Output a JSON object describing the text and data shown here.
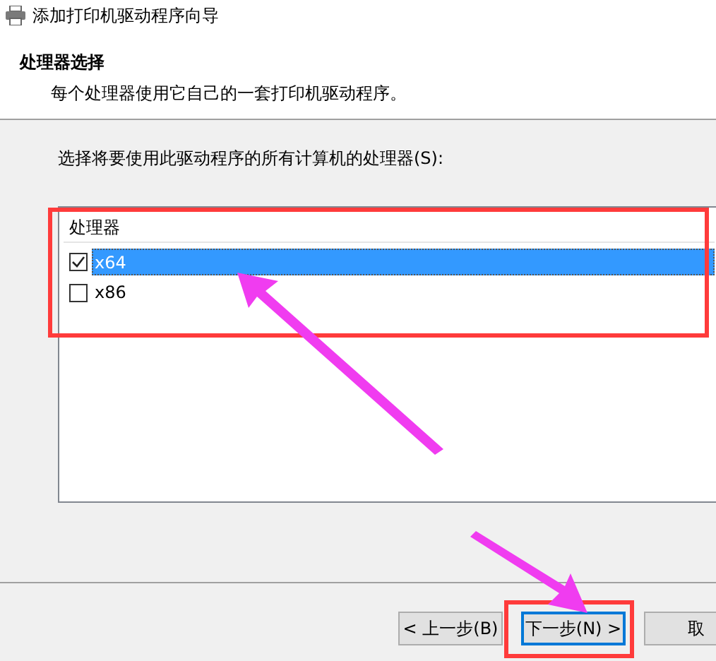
{
  "window": {
    "title": "添加打印机驱动程序向导"
  },
  "header": {
    "title": "处理器选择",
    "subtitle": "每个处理器使用它自己的一套打印机驱动程序。"
  },
  "prompt": "选择将要使用此驱动程序的所有计算机的处理器(S):",
  "list": {
    "column": "处理器",
    "items": [
      {
        "label": "x64",
        "checked": true,
        "selected": true
      },
      {
        "label": "x86",
        "checked": false,
        "selected": false
      }
    ]
  },
  "buttons": [
    {
      "label": "< 上一步(B)",
      "default": false
    },
    {
      "label": "下一步(N) >",
      "default": true
    },
    {
      "label": "取",
      "default": false
    }
  ]
}
